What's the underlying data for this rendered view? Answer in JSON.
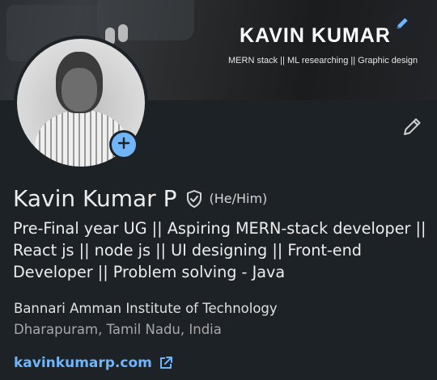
{
  "banner": {
    "title": "KAVIN KUMAR",
    "subtitle": "MERN stack || ML researching || Graphic design"
  },
  "profile": {
    "name": "Kavin Kumar P",
    "pronouns": "(He/Him)",
    "headline": "Pre-Final year UG || Aspiring MERN-stack developer || React js || node js || UI designing || Front-end Developer || Problem solving - Java",
    "school": "Bannari Amman Institute of Technology",
    "location": "Dharapuram, Tamil Nadu, India",
    "website": "kavinkumarp.com"
  },
  "icons": {
    "banner_edit": "pencil-icon",
    "profile_edit": "pencil-icon",
    "add_photo": "plus-icon",
    "verified": "shield-check-icon",
    "external_link": "external-link-icon"
  },
  "colors": {
    "background": "#1d2226",
    "accent": "#70b5f9"
  }
}
